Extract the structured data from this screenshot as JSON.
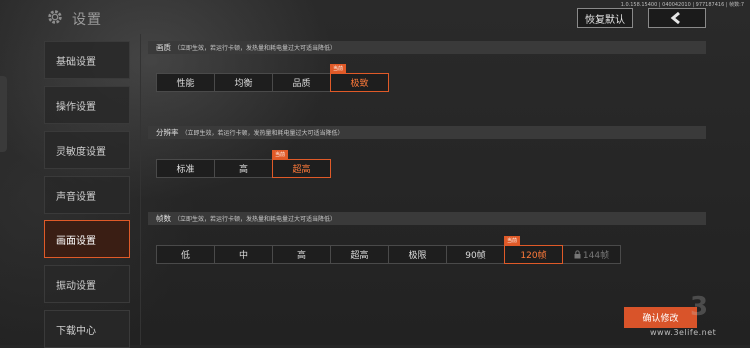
{
  "header": {
    "title": "设置",
    "version": "1.0.158.15400 | 040042010 | 977187416 | 帧数:7",
    "restore_default": "恢复默认"
  },
  "sidebar": {
    "items": [
      {
        "label": "基础设置",
        "active": false
      },
      {
        "label": "操作设置",
        "active": false
      },
      {
        "label": "灵敏度设置",
        "active": false
      },
      {
        "label": "声音设置",
        "active": false
      },
      {
        "label": "画面设置",
        "active": true
      },
      {
        "label": "振动设置",
        "active": false
      },
      {
        "label": "下载中心",
        "active": false
      }
    ]
  },
  "sections": {
    "quality": {
      "title": "画质",
      "note": "（立即生效，若运行卡顿，发热量和耗电量过大可适当降低）",
      "options": [
        "性能",
        "均衡",
        "品质",
        "极致"
      ],
      "selected": "极致",
      "badge": "当前"
    },
    "resolution": {
      "title": "分辨率",
      "note": "（立即生效，若运行卡顿，发热量和耗电量过大可适当降低）",
      "options": [
        "标准",
        "高",
        "超高"
      ],
      "selected": "超高",
      "badge": "当前"
    },
    "framerate": {
      "title": "帧数",
      "note": "（立即生效，若运行卡顿，发热量和耗电量过大可适当降低）",
      "options": [
        "低",
        "中",
        "高",
        "超高",
        "极限",
        "90帧",
        "120帧",
        "144帧"
      ],
      "selected": "120帧",
      "locked": "144帧",
      "badge": "当前"
    }
  },
  "footer": {
    "confirm": "确认修改",
    "watermark": "www.3elife.net"
  },
  "colors": {
    "accent": "#e05a28",
    "background": "#262626"
  }
}
